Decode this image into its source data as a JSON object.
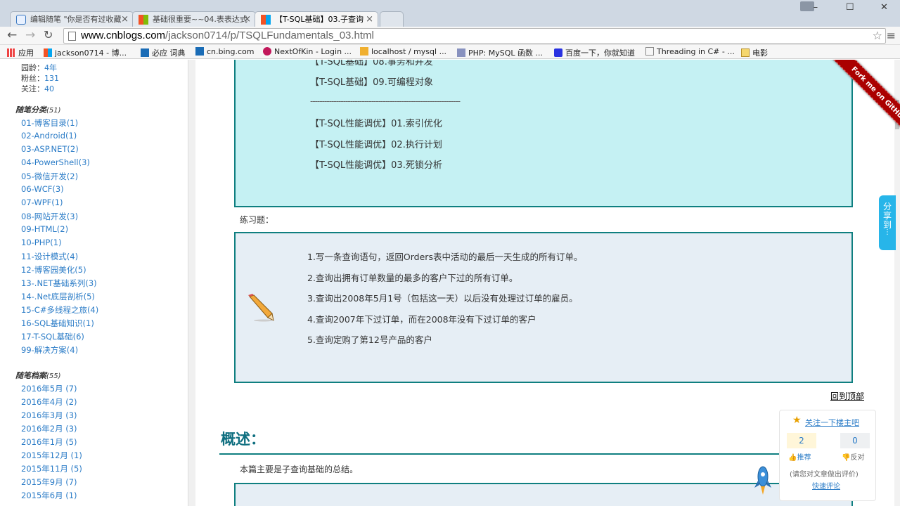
{
  "browser": {
    "tabs": [
      {
        "title": "编辑随笔 \"你是否有过收藏"
      },
      {
        "title": "基础很重要~~04.表表达式"
      },
      {
        "title": "【T-SQL基础】03.子查询"
      }
    ],
    "address": {
      "host": "www.cnblogs.com",
      "path": "/jackson0714/p/TSQLFundamentals_03.html"
    },
    "bookmarks": [
      "应用",
      "jackson0714 - 博...",
      "必应 词典",
      "cn.bing.com",
      "NextOfKin - Login ...",
      "localhost / mysql ...",
      "PHP: MySQL 函数 ...",
      "百度一下，你就知道",
      "Threading in C# - ...",
      "电影"
    ]
  },
  "sidebar": {
    "stats": [
      {
        "label": "园龄：",
        "value": "4年"
      },
      {
        "label": "粉丝：",
        "value": "131"
      },
      {
        "label": "关注：",
        "value": "40"
      }
    ],
    "categories_title": "随笔分类",
    "categories_count": "(51)",
    "categories": [
      "01-博客目录(1)",
      "02-Android(1)",
      "03-ASP.NET(2)",
      "04-PowerShell(3)",
      "05-微信开发(2)",
      "06-WCF(3)",
      "07-WPF(1)",
      "08-网站开发(3)",
      "09-HTML(2)",
      "10-PHP(1)",
      "11-设计模式(4)",
      "12-博客园美化(5)",
      "13-.NET基础系列(3)",
      "14-.Net底层剖析(5)",
      "15-C#多线程之旅(4)",
      "16-SQL基础知识(1)",
      "17-T-SQL基础(6)",
      "99-解决方案(4)"
    ],
    "archives_title": "随笔档案",
    "archives_count": "(55)",
    "archives": [
      "2016年5月 (7)",
      "2016年4月 (2)",
      "2016年3月 (3)",
      "2016年2月 (3)",
      "2016年1月 (5)",
      "2015年12月 (1)",
      "2015年11月 (5)",
      "2015年9月 (7)",
      "2015年6月 (1)"
    ]
  },
  "content": {
    "toc_lines": [
      "【T-SQL基础】08.事务和并发",
      "【T-SQL基础】09.可编程对象",
      "----------------------------------------------------------------",
      "【T-SQL性能调优】01.索引优化",
      "【T-SQL性能调优】02.执行计划",
      "【T-SQL性能调优】03.死锁分析"
    ],
    "exercise_label": "练习题：",
    "questions": [
      "1.写一条查询语句，返回Orders表中活动的最后一天生成的所有订单。",
      "2.查询出拥有订单数量的最多的客户下过的所有订单。",
      "3.查询出2008年5月1号（包括这一天）以后没有处理过订单的雇员。",
      "4.查询2007年下过订单，而在2008年没有下过订单的客户",
      "5.查询定购了第12号产品的客户"
    ],
    "back_to_top": "回到顶部",
    "heading": "概述：",
    "summary": "本篇主要是子查询基础的总结。"
  },
  "fork_ribbon": "Fork me on GitHub",
  "share_tab": "分享到",
  "follow_widget": {
    "title": "关注一下楼主吧",
    "digg_count": "2",
    "bury_count": "0",
    "digg_label": "推荐",
    "bury_label": "反对",
    "hint": "(请您对文章做出评价)",
    "quick_comment": "快速评论"
  }
}
